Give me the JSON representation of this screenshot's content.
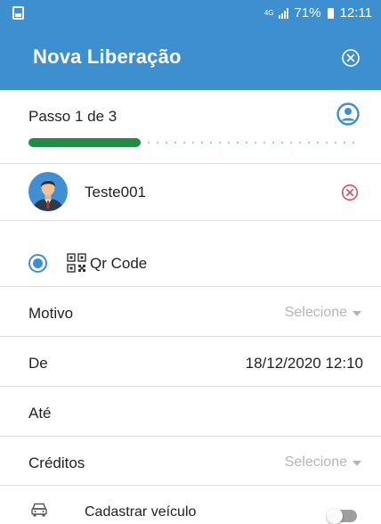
{
  "status_bar": {
    "network": "4G",
    "battery": "71%",
    "time": "12:11"
  },
  "app_bar": {
    "title": "Nova Liberação",
    "close_icon": "close-circle-icon"
  },
  "step": {
    "label": "Passo 1 de 3",
    "progress": 0.34,
    "icon": "user-circle-icon"
  },
  "person": {
    "name": "Teste001",
    "avatar_icon": "avatar-icon",
    "remove_icon": "remove-circle-icon"
  },
  "access_type": {
    "selected": true,
    "icon": "qr-code-icon",
    "label": "Qr Code"
  },
  "fields": {
    "motivo": {
      "label": "Motivo",
      "placeholder": "Selecione"
    },
    "de": {
      "label": "De",
      "value": "18/12/2020 12:10"
    },
    "ate": {
      "label": "Até",
      "value": ""
    },
    "creditos": {
      "label": "Créditos",
      "placeholder": "Selecione"
    }
  },
  "vehicle": {
    "icon": "car-icon",
    "label": "Cadastrar veículo",
    "enabled": false
  },
  "colors": {
    "primary": "#3d8fcf",
    "progress": "#1f8b45",
    "remove": "#d9435e",
    "placeholder": "#b5b5b5"
  }
}
